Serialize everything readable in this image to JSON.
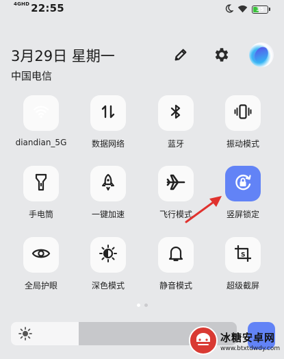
{
  "status_bar": {
    "network_type": "4GHD",
    "time": "22:55",
    "battery_level": "35",
    "battery_fraction": 0.35,
    "icons": [
      "moon-icon",
      "wifi-icon",
      "battery-icon"
    ]
  },
  "header": {
    "date": "3月29日 星期一",
    "carrier": "中国电信",
    "icons": [
      "edit-pencil-icon",
      "settings-gear-icon",
      "account-avatar-icon"
    ]
  },
  "tiles": [
    {
      "label": "diandian_5G",
      "icon": "wifi-icon",
      "active": true
    },
    {
      "label": "数据网络",
      "icon": "mobile-data-icon",
      "active": false
    },
    {
      "label": "蓝牙",
      "icon": "bluetooth-icon",
      "active": false
    },
    {
      "label": "振动模式",
      "icon": "vibrate-icon",
      "active": false
    },
    {
      "label": "手电筒",
      "icon": "flashlight-icon",
      "active": false
    },
    {
      "label": "一键加速",
      "icon": "rocket-icon",
      "active": false
    },
    {
      "label": "飞行模式",
      "icon": "airplane-icon",
      "active": false
    },
    {
      "label": "竖屏锁定",
      "icon": "rotation-lock-icon",
      "active": true
    },
    {
      "label": "全局护眼",
      "icon": "eye-icon",
      "active": false
    },
    {
      "label": "深色模式",
      "icon": "dark-mode-icon",
      "active": false
    },
    {
      "label": "静音模式",
      "icon": "bell-icon",
      "active": false
    },
    {
      "label": "超级截屏",
      "icon": "screenshot-icon",
      "active": false
    }
  ],
  "pagination": {
    "pages": 2,
    "current": 1
  },
  "brightness": {
    "level_fraction": 0.3,
    "icon": "brightness-icon"
  },
  "annotation": {
    "icon": "red-arrow-icon"
  },
  "watermark": {
    "title": "冰糖安卓网",
    "url": "www.btxtdwdy.com"
  },
  "colors": {
    "accent": "#6283f6",
    "background": "#e7e8ea",
    "tile": "#fafafa",
    "arrow": "#e0322e"
  }
}
